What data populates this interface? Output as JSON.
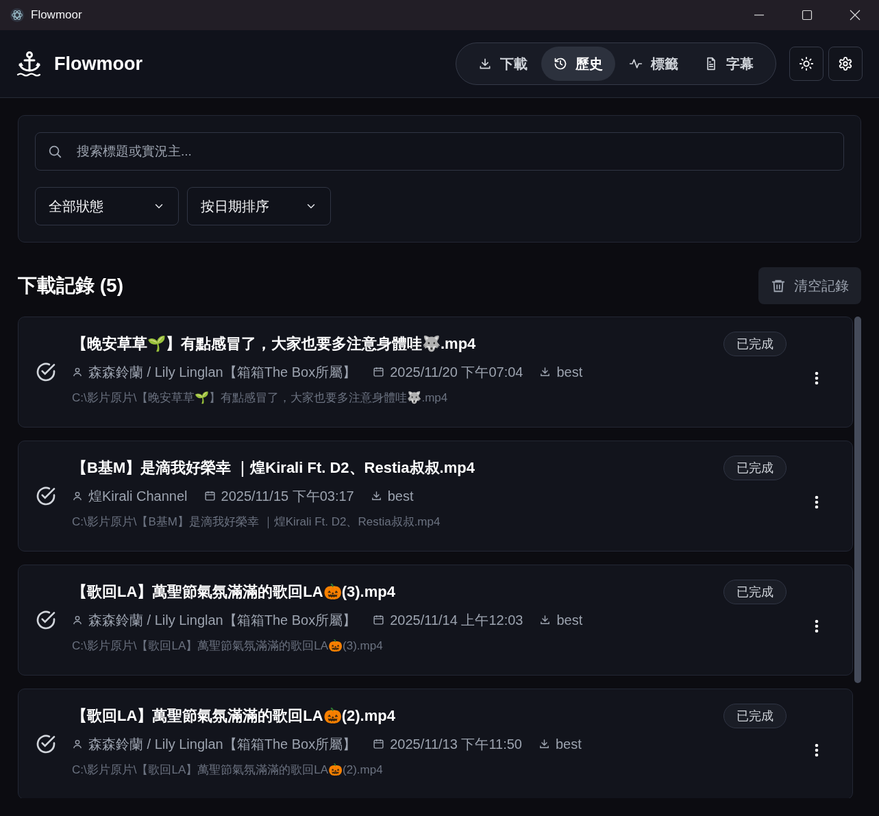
{
  "window": {
    "title": "Flowmoor"
  },
  "app": {
    "name": "Flowmoor"
  },
  "tabs": [
    {
      "label": "下載",
      "kind": "download",
      "selected": false
    },
    {
      "label": "歷史",
      "kind": "history",
      "selected": true
    },
    {
      "label": "標籤",
      "kind": "activity",
      "selected": false
    },
    {
      "label": "字幕",
      "kind": "file",
      "selected": false
    }
  ],
  "search": {
    "placeholder": "搜索標題或實況主..."
  },
  "filters": [
    "全部狀態",
    "按日期排序"
  ],
  "list_heading": "下載記錄 (5)",
  "clear_button": "清空記錄",
  "records": [
    {
      "title": "【晚安草草🌱】有點感冒了，大家也要多注意身體哇🐺.mp4",
      "author": "森森鈴蘭 / Lily Linglan【箱箱The Box所屬】",
      "date": "2025/11/20 下午07:04",
      "quality": "best",
      "path": "C:\\影片原片\\【晚安草草🌱】有點感冒了，大家也要多注意身體哇🐺.mp4",
      "status": "已完成"
    },
    {
      "title": "【B基M】是滴我好榮幸 ｜煌Kirali Ft. D2、Restia叔叔.mp4",
      "author": "煌Kirali Channel",
      "date": "2025/11/15 下午03:17",
      "quality": "best",
      "path": "C:\\影片原片\\【B基M】是滴我好榮幸 ｜煌Kirali Ft. D2、Restia叔叔.mp4",
      "status": "已完成"
    },
    {
      "title": "【歌回LA】萬聖節氣氛滿滿的歌回LA🎃(3).mp4",
      "author": "森森鈴蘭 / Lily Linglan【箱箱The Box所屬】",
      "date": "2025/11/14 上午12:03",
      "quality": "best",
      "path": "C:\\影片原片\\【歌回LA】萬聖節氣氛滿滿的歌回LA🎃(3).mp4",
      "status": "已完成"
    },
    {
      "title": "【歌回LA】萬聖節氣氛滿滿的歌回LA🎃(2).mp4",
      "author": "森森鈴蘭 / Lily Linglan【箱箱The Box所屬】",
      "date": "2025/11/13 下午11:50",
      "quality": "best",
      "path": "C:\\影片原片\\【歌回LA】萬聖節氣氛滿滿的歌回LA🎃(2).mp4",
      "status": "已完成"
    }
  ]
}
